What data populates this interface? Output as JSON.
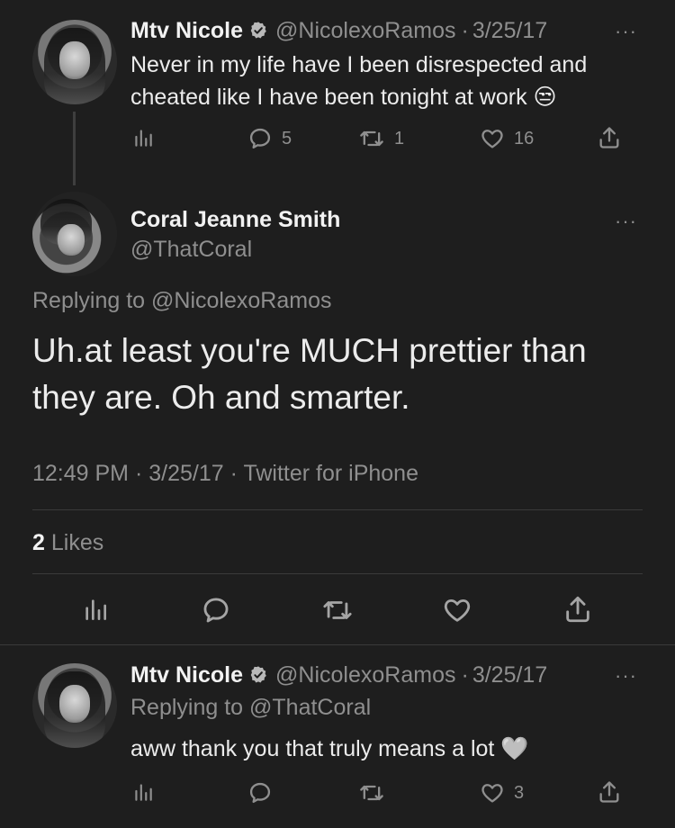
{
  "tweet1": {
    "name": "Mtv Nicole",
    "handle": "@NicolexoRamos",
    "sep": "·",
    "date": "3/25/17",
    "text": "Never in my life have I been disrespected and cheated like I have been tonight at work",
    "emoji": "😒",
    "replies": "5",
    "retweets": "1",
    "likes": "16",
    "more": "···"
  },
  "tweet2": {
    "name": "Coral Jeanne Smith",
    "handle": "@ThatCoral",
    "replying_prefix": "Replying to",
    "replying_handle": "@NicolexoRamos",
    "text": "Uh.at least you're MUCH prettier than they are. Oh and smarter.",
    "time": "12:49 PM",
    "date": "3/25/17",
    "source": "Twitter for iPhone",
    "sep": "·",
    "likes_count": "2",
    "likes_label": "Likes",
    "more": "···"
  },
  "tweet3": {
    "name": "Mtv Nicole",
    "handle": "@NicolexoRamos",
    "sep": "·",
    "date": "3/25/17",
    "replying_prefix": "Replying to",
    "replying_handle": "@ThatCoral",
    "text": "aww thank you that truly means a lot",
    "emoji": "🤍",
    "likes": "3",
    "more": "···"
  },
  "icons": {
    "analytics": "analytics-icon",
    "reply": "reply-icon",
    "retweet": "retweet-icon",
    "like": "heart-icon",
    "share": "share-icon",
    "verified": "verified-badge-icon"
  },
  "colors": {
    "background": "#1e1e1e",
    "text": "#ececec",
    "muted": "#8f8f8f",
    "divider": "#3a3a3a"
  }
}
